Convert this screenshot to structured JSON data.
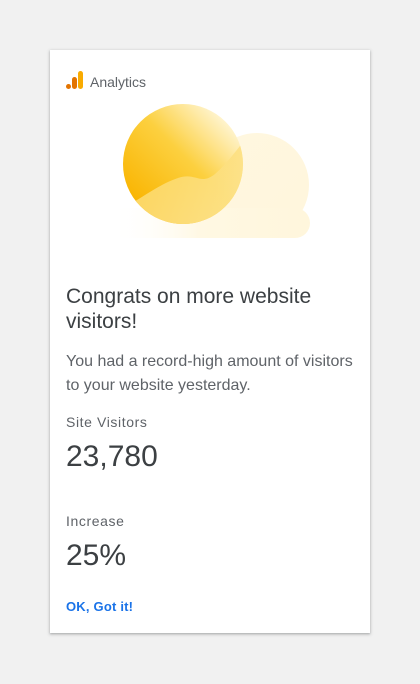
{
  "brand": {
    "name": "Analytics",
    "icon": "analytics-logo-icon",
    "colors": [
      "#f9ab00",
      "#e37400"
    ]
  },
  "hero": {
    "icon": "sun-cloud-illustration"
  },
  "card": {
    "title": "Congrats on more website visitors!",
    "description": "You had a record-high amount of visitors to your website yesterday."
  },
  "metrics": [
    {
      "label": "Site Visitors",
      "value": "23,780"
    },
    {
      "label": "Increase",
      "value": "25%"
    }
  ],
  "actions": {
    "ok_label": "OK, Got it!",
    "accent_color": "#1a73e8"
  }
}
